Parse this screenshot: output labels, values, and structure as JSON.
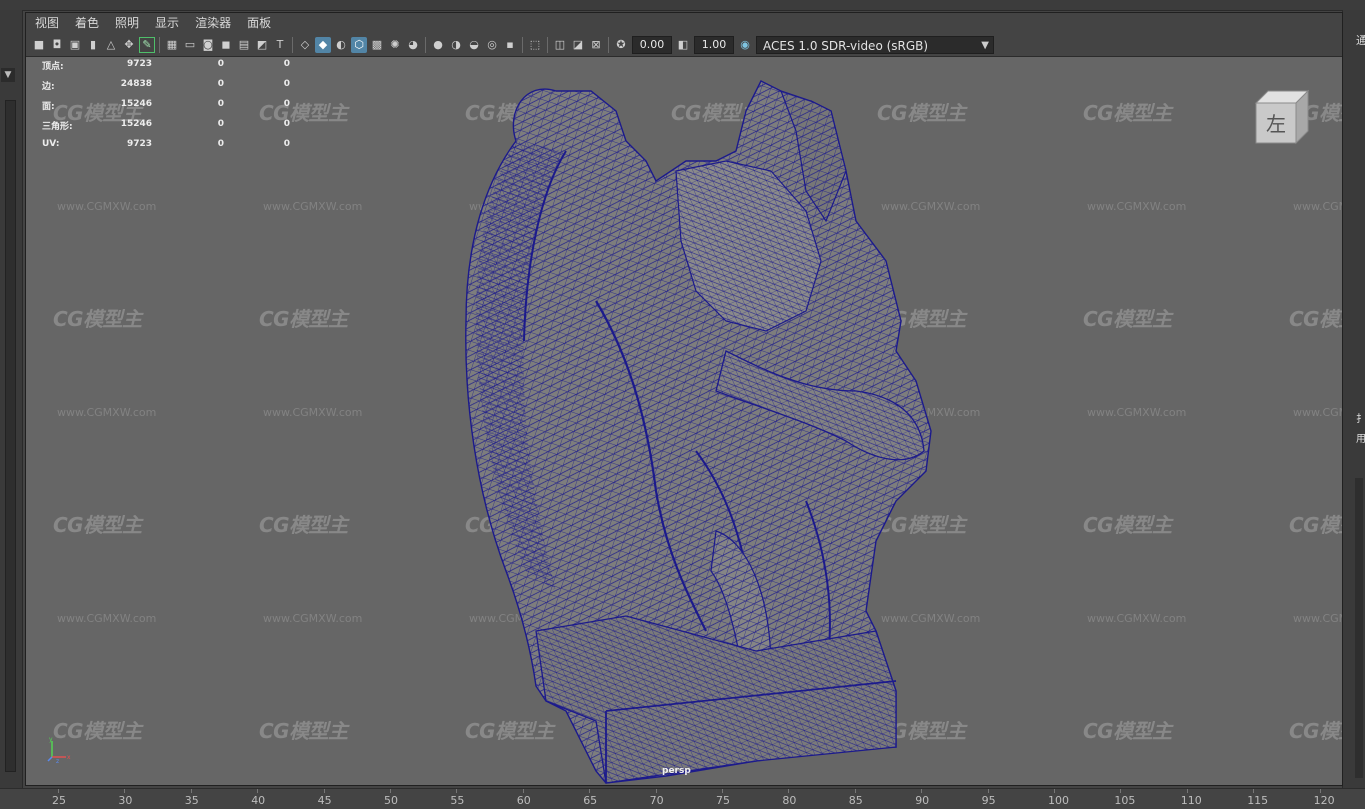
{
  "menu": [
    "视图",
    "着色",
    "照明",
    "显示",
    "渲染器",
    "面板"
  ],
  "toolbar": {
    "icons": [
      "camera-icon",
      "camera-attributes-icon",
      "image-plane-icon",
      "bookmark-icon",
      "2d-pan-zoom-icon",
      "grease-pencil-icon",
      "isolate-icon",
      "grid-icon",
      "film-gate-icon",
      "resolution-gate-icon",
      "gate-mask-icon",
      "field-chart-icon",
      "safe-action-icon",
      "safe-title-icon",
      "wireframe-icon",
      "smooth-shade-icon",
      "flat-shade-icon",
      "wireframe-on-shaded-icon",
      "xray-icon",
      "use-lights-icon",
      "shadows-icon",
      "ambient-occlusion-icon",
      "motion-blur-icon",
      "anti-aliasing-icon",
      "depth-of-field-icon",
      "hud-icon",
      "select-tool-icon",
      "isolate-select-icon",
      "xray-joints-icon",
      "xray-active-icon",
      "exposure-icon",
      "gamma-icon",
      "color-management-icon"
    ],
    "exposure": "0.00",
    "gamma": "1.00",
    "color_space": "ACES 1.0 SDR-video (sRGB)"
  },
  "hud": {
    "rows": [
      {
        "label": "顶点:",
        "v1": "9723",
        "v2": "0",
        "v3": "0"
      },
      {
        "label": "边:",
        "v1": "24838",
        "v2": "0",
        "v3": "0"
      },
      {
        "label": "面:",
        "v1": "15246",
        "v2": "0",
        "v3": "0"
      },
      {
        "label": "三角形:",
        "v1": "15246",
        "v2": "0",
        "v3": "0"
      },
      {
        "label": "UV:",
        "v1": "9723",
        "v2": "0",
        "v3": "0"
      }
    ]
  },
  "watermark": {
    "logo_text": "CG模型主",
    "url_text": "www.CGMXW.com"
  },
  "viewcube": {
    "label": "左"
  },
  "camera": {
    "name": "persp"
  },
  "axis": {
    "x": "x",
    "y": "y",
    "z": "z"
  },
  "right_panel": {
    "top_char": "通",
    "mid_chars": [
      "扌",
      "用"
    ]
  },
  "ruler": {
    "labels": [
      "25",
      "30",
      "35",
      "40",
      "45",
      "50",
      "55",
      "60",
      "65",
      "70",
      "75",
      "80",
      "85",
      "90",
      "95",
      "100",
      "105",
      "110",
      "115",
      "120"
    ]
  },
  "colors": {
    "viewport_bg": "#666666",
    "wireframe": "#1c1a8c",
    "active_button": "#5285a6"
  }
}
